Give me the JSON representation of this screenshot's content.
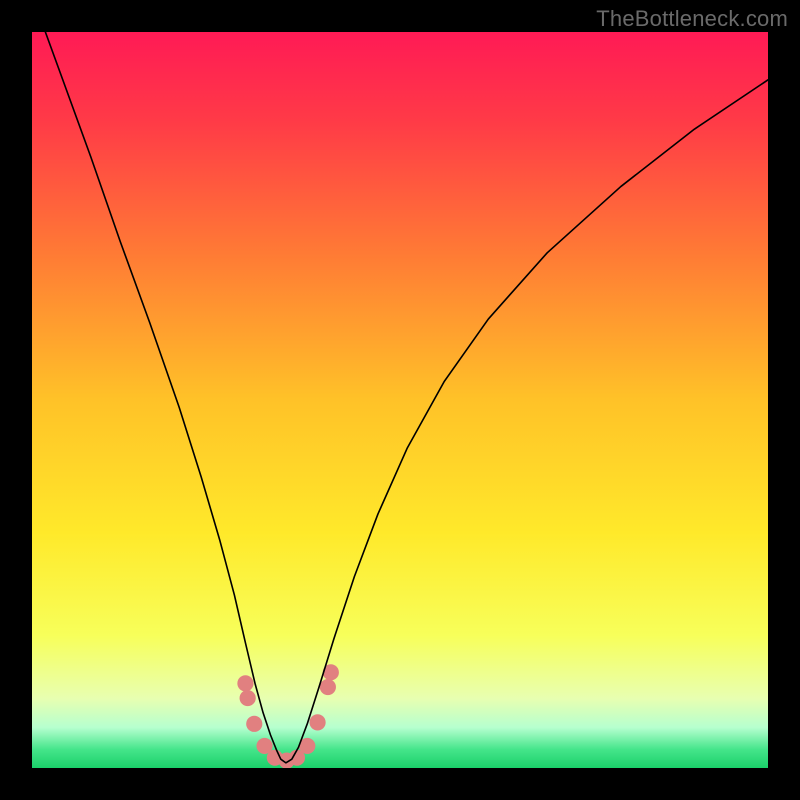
{
  "watermark": "TheBottleneck.com",
  "chart_data": {
    "type": "line",
    "title": "",
    "xlabel": "",
    "ylabel": "",
    "xlim": [
      0,
      1000
    ],
    "ylim": [
      0,
      1000
    ],
    "grid": false,
    "legend": false,
    "background_gradient": {
      "direction": "vertical",
      "stops": [
        {
          "pos": 0.0,
          "color": "#ff1a55"
        },
        {
          "pos": 0.12,
          "color": "#ff3a47"
        },
        {
          "pos": 0.3,
          "color": "#ff7a35"
        },
        {
          "pos": 0.5,
          "color": "#ffc228"
        },
        {
          "pos": 0.68,
          "color": "#ffe92a"
        },
        {
          "pos": 0.82,
          "color": "#f7ff5a"
        },
        {
          "pos": 0.905,
          "color": "#e8ffb0"
        },
        {
          "pos": 0.945,
          "color": "#b6ffcf"
        },
        {
          "pos": 0.975,
          "color": "#44e58a"
        },
        {
          "pos": 1.0,
          "color": "#1bd06a"
        }
      ]
    },
    "series": [
      {
        "name": "bottleneck-curve",
        "color": "#000000",
        "width": 2.2,
        "x": [
          0,
          40,
          80,
          120,
          160,
          200,
          230,
          255,
          275,
          290,
          303,
          314,
          324,
          332,
          338,
          345,
          353,
          362,
          374,
          390,
          410,
          438,
          470,
          510,
          560,
          620,
          700,
          800,
          900,
          1000
        ],
        "values": [
          1050,
          940,
          830,
          715,
          605,
          490,
          395,
          310,
          235,
          170,
          115,
          75,
          45,
          25,
          12,
          7,
          12,
          28,
          60,
          110,
          175,
          260,
          345,
          435,
          525,
          610,
          700,
          790,
          868,
          935
        ]
      }
    ],
    "markers": {
      "name": "highlight-dots",
      "color": "#e18080",
      "radius": 11,
      "points": [
        {
          "x": 290,
          "y": 115
        },
        {
          "x": 293,
          "y": 95
        },
        {
          "x": 302,
          "y": 60
        },
        {
          "x": 316,
          "y": 30
        },
        {
          "x": 330,
          "y": 14
        },
        {
          "x": 346,
          "y": 10
        },
        {
          "x": 360,
          "y": 14
        },
        {
          "x": 374,
          "y": 30
        },
        {
          "x": 388,
          "y": 62
        },
        {
          "x": 402,
          "y": 110
        },
        {
          "x": 406,
          "y": 130
        }
      ]
    }
  }
}
